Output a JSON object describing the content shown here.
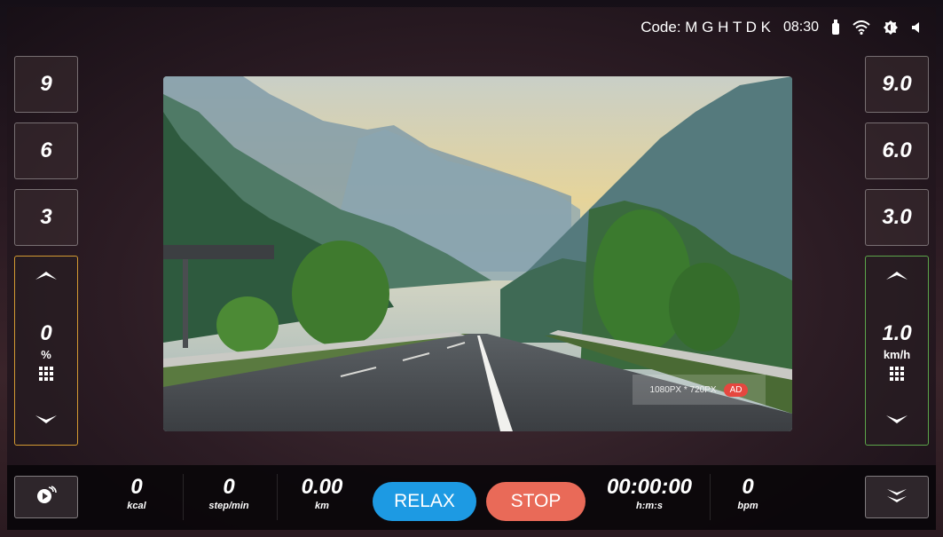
{
  "status": {
    "code_text": "Code: M G H T D K",
    "time": "08:30"
  },
  "incline": {
    "presets": [
      "9",
      "6",
      "3"
    ],
    "value": "0",
    "unit": "%"
  },
  "speed": {
    "presets": [
      "9.0",
      "6.0",
      "3.0"
    ],
    "value": "1.0",
    "unit": "km/h"
  },
  "ad": {
    "size_text": "1080PX * 720PX",
    "badge": "AD"
  },
  "stats": {
    "calories": {
      "value": "0",
      "unit": "kcal"
    },
    "steps": {
      "value": "0",
      "unit": "step/min"
    },
    "distance": {
      "value": "0.00",
      "unit": "km"
    },
    "time": {
      "value": "00:00:00",
      "unit": "h:m:s"
    },
    "heart": {
      "value": "0",
      "unit": "bpm"
    }
  },
  "buttons": {
    "relax": "RELAX",
    "stop": "STOP"
  },
  "icons": {
    "usb": "usb-icon",
    "wifi": "wifi-icon",
    "brightness": "brightness-icon",
    "volume": "volume-icon",
    "up": "chevron-up-icon",
    "down": "chevron-down-icon",
    "keypad": "keypad-icon",
    "media": "media-icon",
    "collapse": "double-chevron-down-icon"
  },
  "colors": {
    "relax": "#1d9ae3",
    "stop": "#e96a58",
    "incline_border": "#d39a32",
    "speed_border": "#5ca54a"
  }
}
